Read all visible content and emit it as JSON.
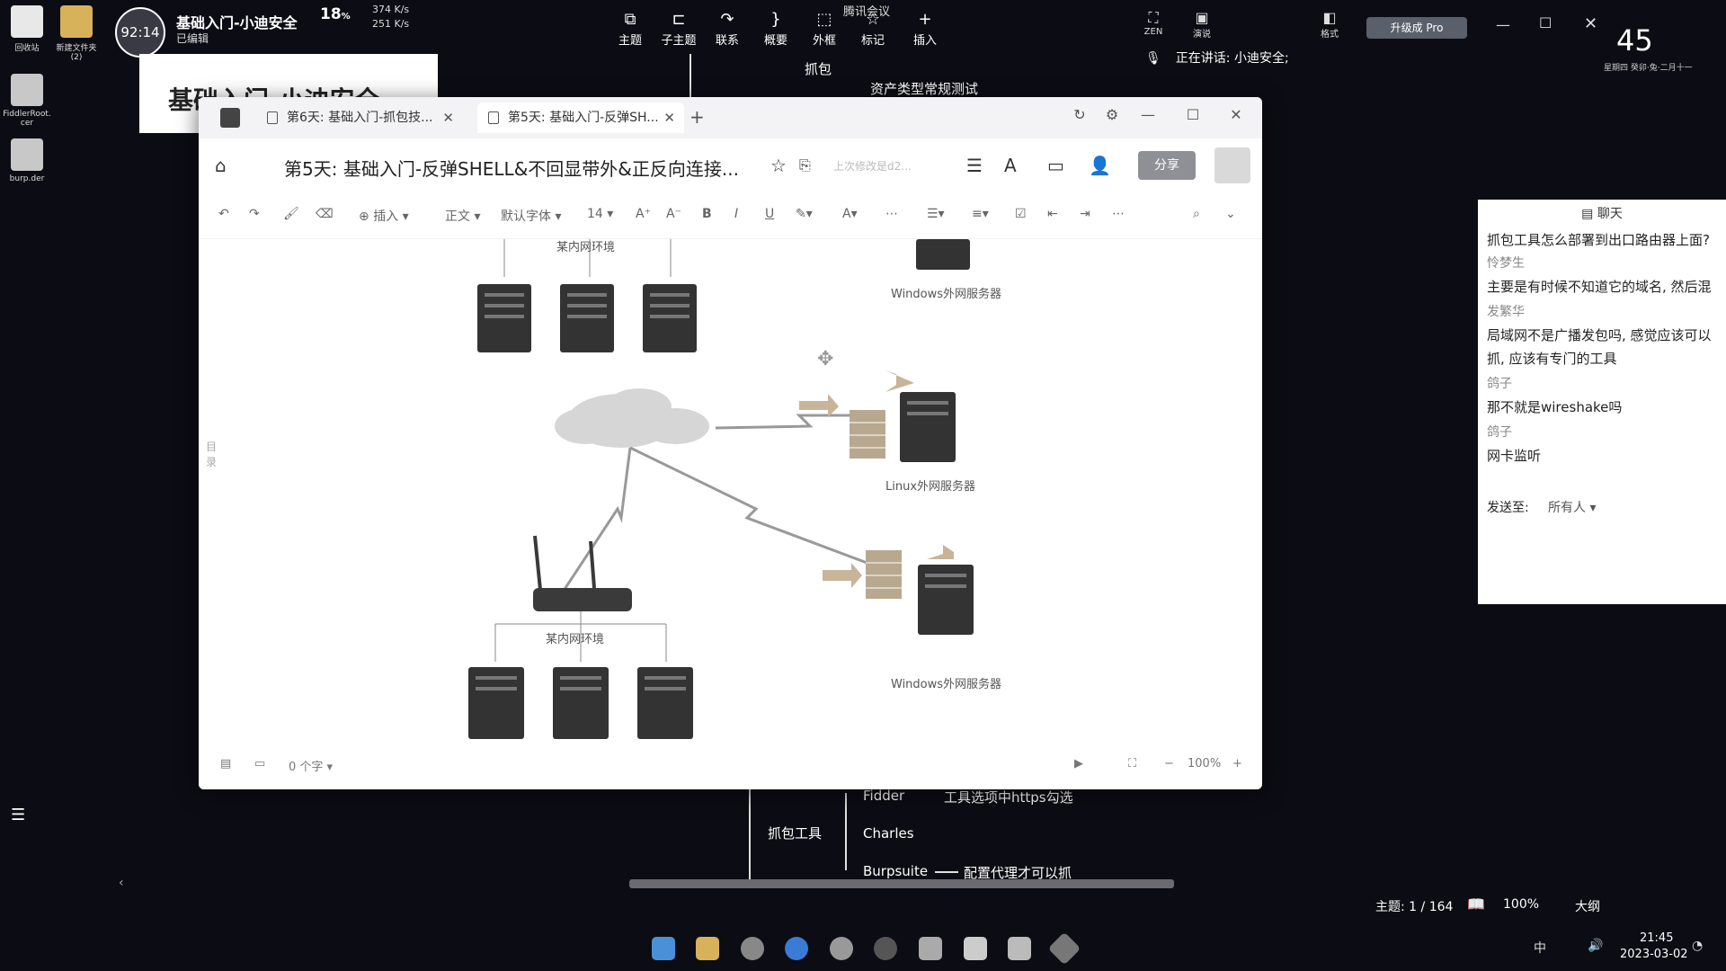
{
  "desktop": {
    "icons": [
      {
        "label": "回收站"
      },
      {
        "label": "新建文件夹\n(2)"
      },
      {
        "label": "FiddlerRoot.\ncer"
      },
      {
        "label": "burp.der"
      }
    ]
  },
  "topbar": {
    "timer": "92:14",
    "file_title": "基础入门-小迪安全",
    "file_status": "已编辑",
    "cpu": "18",
    "cpu_unit": "%",
    "net_up": "374 K/s",
    "net_down": "251 K/s",
    "meeting_label": "腾讯会议",
    "speaking": "正在讲话: 小迪安全;",
    "upgrade_label": "升级成 Pro",
    "clock_big": "45",
    "date_small": "星期四  癸卯·兔·二月十一",
    "toolbar": [
      {
        "label": "主题",
        "icon": "topic-icon"
      },
      {
        "label": "子主题",
        "icon": "subtopic-icon"
      },
      {
        "label": "联系",
        "icon": "link-icon"
      },
      {
        "label": "概要",
        "icon": "summary-icon"
      },
      {
        "label": "外框",
        "icon": "frame-icon"
      },
      {
        "label": "标记",
        "icon": "marker-icon"
      },
      {
        "label": "插入",
        "icon": "insert-icon"
      }
    ],
    "right_tools": [
      {
        "label": "ZEN"
      },
      {
        "label": "演说"
      },
      {
        "label": "格式"
      }
    ]
  },
  "mindmap": {
    "bg_title": "基础入门-小迪安全",
    "node_capture": "抓包",
    "node_asset": "资产类型常规测试",
    "node_tools": "抓包工具",
    "tool_fiddler": "Fidder",
    "tool_fiddler_note": "工具选项中https勾选",
    "tool_charles": "Charles",
    "tool_burp": "Burpsuite",
    "tool_burp_note": "配置代理才可以抓",
    "status_topic": "主题: 1 / 164",
    "status_zoom": "100%",
    "status_outline": "大纲"
  },
  "doc": {
    "tabs": [
      {
        "label": "第6天: 基础入门-抓包技..."
      },
      {
        "label": "第5天: 基础入门-反弹SH..."
      }
    ],
    "title": "第5天: 基础入门-反弹SHELL&不回显带外&正反向连接...",
    "save_status": "上次修改是d2...",
    "share_label": "分享",
    "format": {
      "insert": "插入",
      "style": "正文",
      "font": "默认字体",
      "size": "14"
    },
    "toc_label": "目\n录",
    "word_count": "0 个字",
    "zoom": "100%",
    "diagram": {
      "label_top_lan": "某内网环境",
      "label_win_top": "Windows外网服务器",
      "label_linux": "Linux外网服务器",
      "label_lan": "某内网环境",
      "label_win_bottom": "Windows外网服务器"
    }
  },
  "chat": {
    "title": "聊天",
    "messages": [
      {
        "name": "",
        "text": "抓包工具怎么部署到出口路由器上面?"
      },
      {
        "name": "怜梦生",
        "text": "主要是有时候不知道它的域名, 然后混"
      },
      {
        "name": "发繁华",
        "text": "局域网不是广播发包吗, 感觉应该可以"
      },
      {
        "name": "",
        "text": "抓, 应该有专门的工具"
      },
      {
        "name": "鸽子",
        "text": "那不就是wireshake吗"
      },
      {
        "name": "鸽子",
        "text": "网卡监听"
      }
    ],
    "send_to_label": "发送至:",
    "send_to_value": "所有人"
  },
  "taskbar": {
    "time": "21:45",
    "date": "2023-03-02",
    "ime": "中"
  }
}
